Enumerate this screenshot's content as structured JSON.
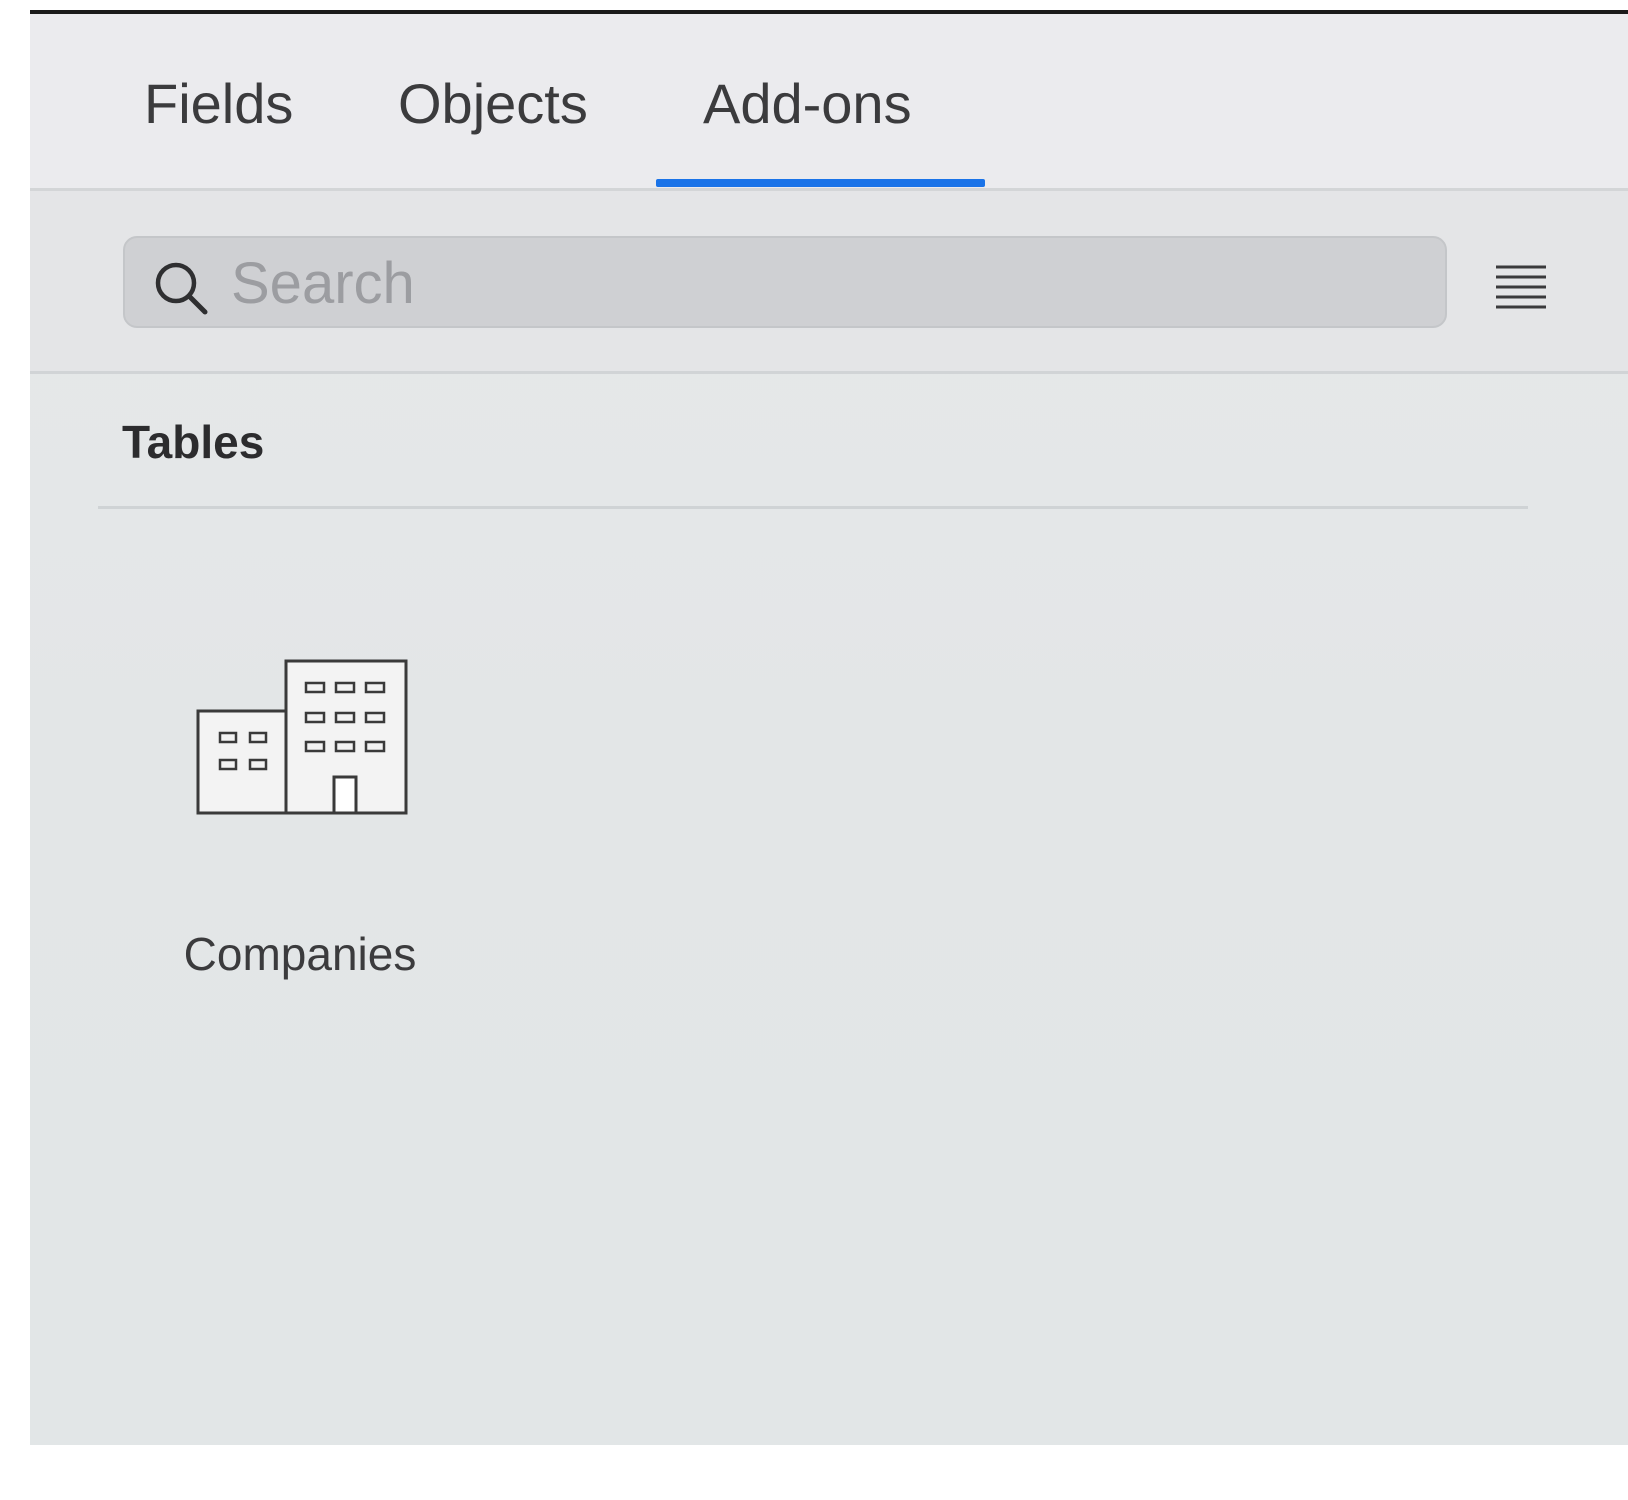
{
  "tabs": [
    {
      "label": "Fields",
      "active": false
    },
    {
      "label": "Objects",
      "active": false
    },
    {
      "label": "Add-ons",
      "active": true
    }
  ],
  "accent_color": "#1a73e8",
  "search": {
    "placeholder": "Search",
    "value": "",
    "icon": "search-icon"
  },
  "view_toggle_icon": "list-view-icon",
  "section": {
    "title": "Tables",
    "items": [
      {
        "label": "Companies",
        "icon": "building-icon"
      }
    ]
  }
}
